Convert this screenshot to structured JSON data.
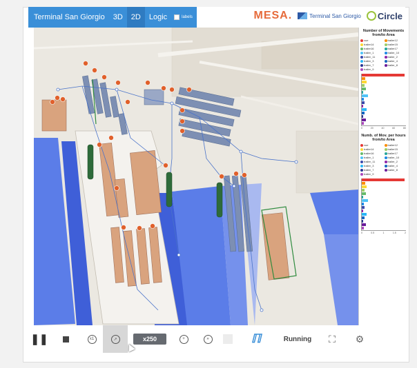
{
  "app": {
    "title": "Terminal San Giorgio",
    "tabs": [
      {
        "label": "3D",
        "active": false
      },
      {
        "label": "2D",
        "active": true
      },
      {
        "label": "Logic",
        "active": false
      }
    ],
    "checkbox_label": "labels",
    "logos": {
      "mesa": "MESA.",
      "terminal": "Terminal San Giorgio",
      "circle": "Circle"
    }
  },
  "panel": {
    "section1": {
      "title": "Number of Movements from/to Area",
      "legend": [
        {
          "label": "vue",
          "color": "#e53935"
        },
        {
          "label": "trailer12",
          "color": "#fb8c00"
        },
        {
          "label": "trailer14",
          "color": "#fdd835"
        },
        {
          "label": "trailer15",
          "color": "#9ccc65"
        },
        {
          "label": "trailer16",
          "color": "#66bb6a"
        },
        {
          "label": "trailer17",
          "color": "#26a69a"
        },
        {
          "label": "trailer_1",
          "color": "#4fc3f7"
        },
        {
          "label": "trailer_10",
          "color": "#1e88e5"
        },
        {
          "label": "trailer_11",
          "color": "#3949ab"
        },
        {
          "label": "trailer_2",
          "color": "#8e24aa"
        },
        {
          "label": "trailer_3",
          "color": "#29b6f6"
        },
        {
          "label": "trailer_4",
          "color": "#1565c0"
        },
        {
          "label": "trailer_7",
          "color": "#283593"
        },
        {
          "label": "trailer_8",
          "color": "#6a1b9a"
        },
        {
          "label": "trailer_9",
          "color": "#ab47bc"
        }
      ],
      "axis": [
        "0",
        "20",
        "40",
        "60",
        "80"
      ]
    },
    "section2": {
      "title": "Numb. of Mov. per hours from/to Area",
      "axis": [
        "0",
        "0.5",
        "1",
        "1.5",
        "2"
      ]
    }
  },
  "toolbar": {
    "x1_label": "x1",
    "speed": "x250",
    "status": "Running",
    "icons": [
      "pause-icon",
      "stop-icon",
      "speed-reset-icon",
      "speed-up-icon",
      "slow-down-icon",
      "fast-forward-icon",
      "logo-icon",
      "fullscreen-icon",
      "settings-icon"
    ]
  },
  "colors": {
    "accent": "#3a8fd8",
    "water": "#5b7de8",
    "quay": "#d9a37e",
    "marker": "#e0602b",
    "ship": "#2e6b3a"
  }
}
